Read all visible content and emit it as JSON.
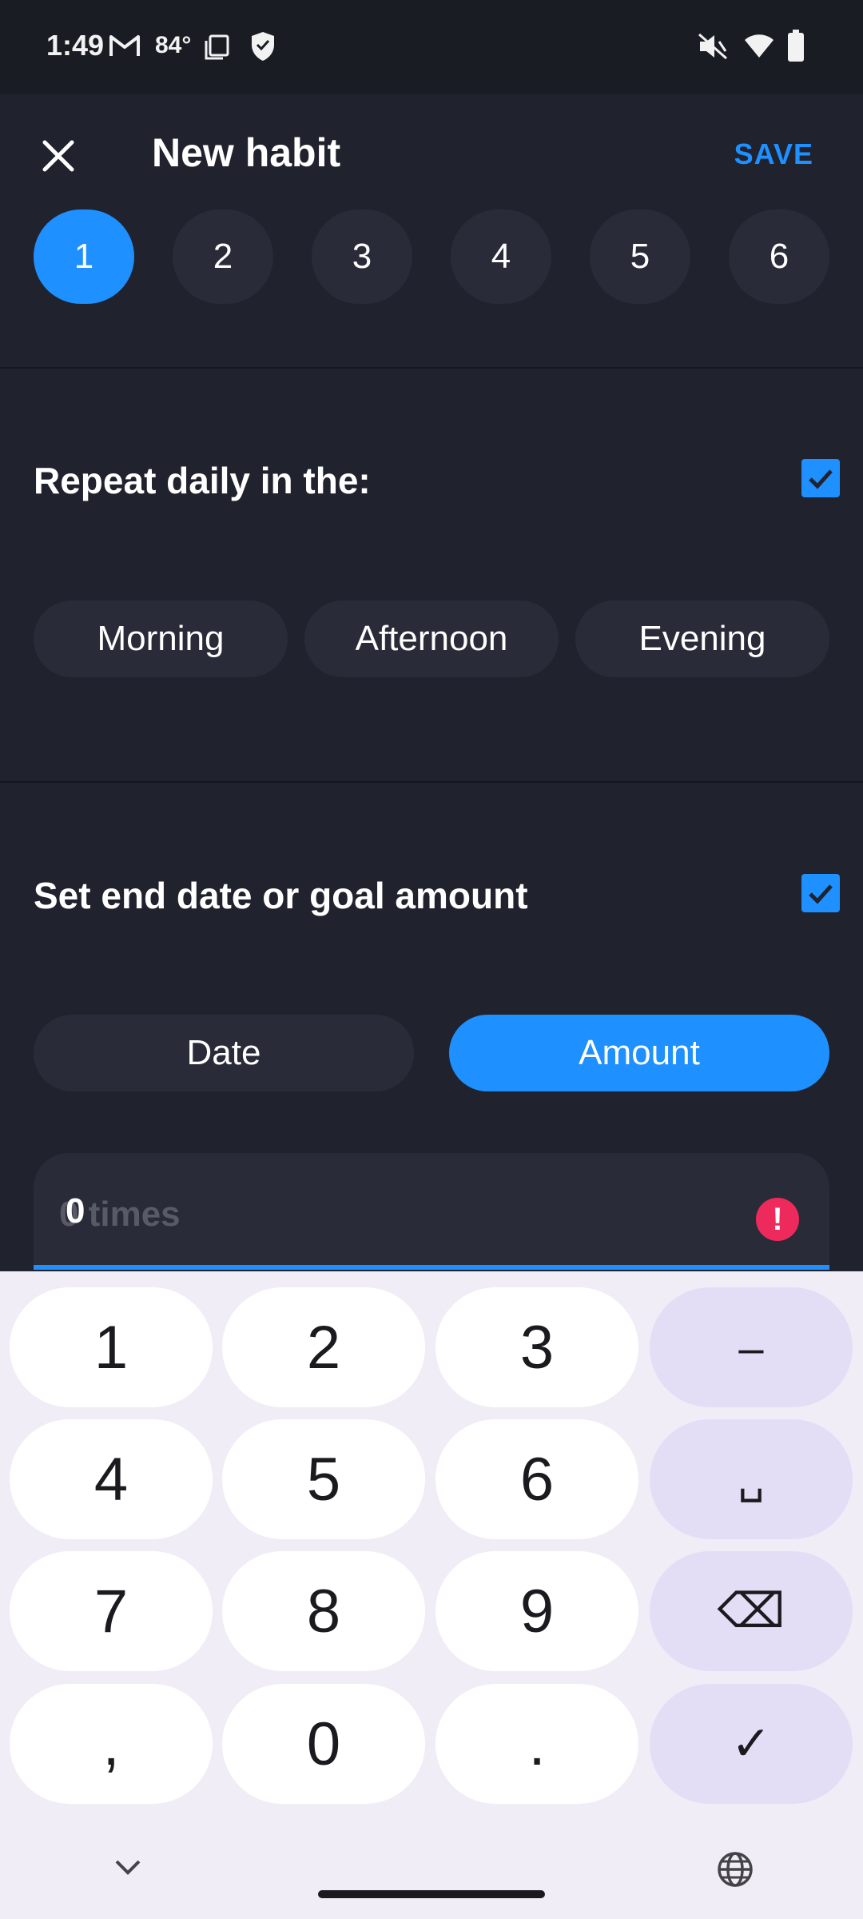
{
  "status_bar": {
    "time": "1:49",
    "temperature": "84°",
    "icons": [
      "gmail-icon",
      "screen-icon",
      "shield-icon",
      "vibrate-off-icon",
      "wifi-icon",
      "battery-icon"
    ]
  },
  "header": {
    "title": "New habit",
    "save_label": "SAVE"
  },
  "frequency": {
    "options": [
      "1",
      "2",
      "3",
      "4",
      "5",
      "6"
    ],
    "selected": "1"
  },
  "repeat_daily": {
    "label": "Repeat daily in the:",
    "checked": true,
    "times": [
      "Morning",
      "Afternoon",
      "Evening"
    ]
  },
  "end_goal": {
    "label": "Set end date or goal amount",
    "checked": true,
    "modes": [
      "Date",
      "Amount"
    ],
    "selected_mode": "Amount",
    "amount_value": "0",
    "amount_placeholder": "0 times"
  },
  "keyboard": {
    "rows": [
      [
        "1",
        "2",
        "3",
        "–"
      ],
      [
        "4",
        "5",
        "6",
        "␣"
      ],
      [
        "7",
        "8",
        "9",
        "⌫"
      ],
      [
        ",",
        "0",
        ".",
        "✓"
      ]
    ]
  },
  "colors": {
    "accent": "#1e90ff",
    "background": "#20232e",
    "surface": "#292c38",
    "error": "#ee2a5d",
    "keyboard_bg": "#f0edf6"
  }
}
